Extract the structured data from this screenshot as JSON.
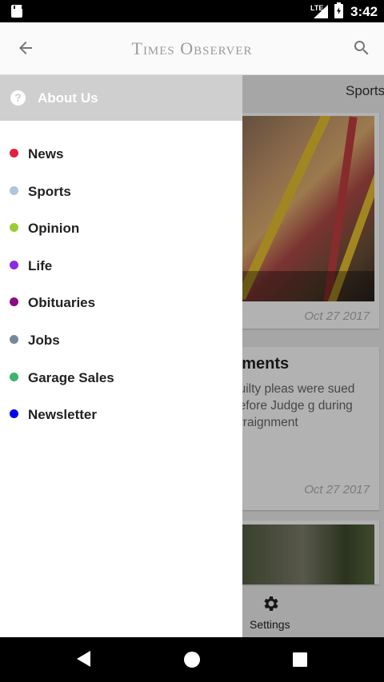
{
  "status_bar": {
    "network": "LTE",
    "time": "3:42"
  },
  "header": {
    "title": "Times Observer"
  },
  "background": {
    "category": "Sports",
    "card1": {
      "date": "Oct 27 2017"
    },
    "card2": {
      "headline": "nments",
      "summary": "guilty pleas were sued before Judge g during arraignment",
      "date": "Oct 27 2017"
    },
    "bottom_tab": {
      "settings_label": "Settings"
    }
  },
  "drawer": {
    "about_label": "About Us",
    "items": [
      {
        "label": "News",
        "color": "#e0213f"
      },
      {
        "label": "Sports",
        "color": "#b0c4de"
      },
      {
        "label": "Opinion",
        "color": "#9acd32"
      },
      {
        "label": "Life",
        "color": "#8a2be2"
      },
      {
        "label": "Obituaries",
        "color": "#8b0a7e"
      },
      {
        "label": "Jobs",
        "color": "#778899"
      },
      {
        "label": "Garage Sales",
        "color": "#3cb371"
      },
      {
        "label": "Newsletter",
        "color": "#0000ee"
      }
    ]
  }
}
